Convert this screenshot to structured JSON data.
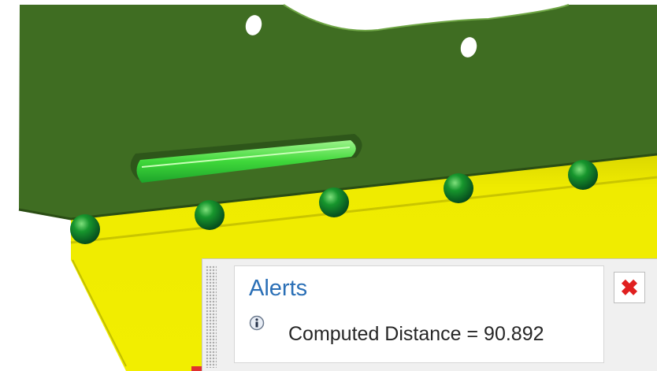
{
  "viewport": {
    "part_color": "#3f6d22",
    "base_color": "#e8e400",
    "marker_color": "#0f8a2a",
    "marker_count": 5
  },
  "alerts": {
    "title": "Alerts",
    "icon": "info-icon",
    "message": "Computed Distance = 90.892",
    "close_icon": "close-icon"
  }
}
